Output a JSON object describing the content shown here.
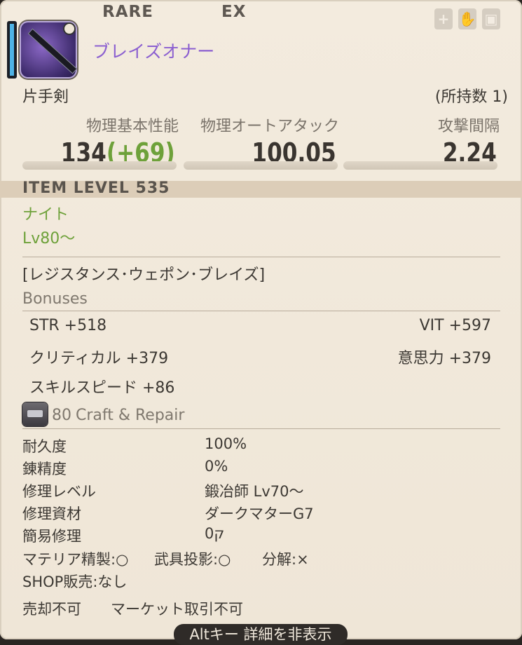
{
  "header": {
    "rarity": "RARE",
    "ex": "EX",
    "item_name": "ブレイズオナー",
    "icon_name": "sword-icon",
    "status_icons": [
      "plus-shield-icon",
      "hand-icon",
      "crate-icon"
    ]
  },
  "item_type": "片手剣",
  "owned_count": "(所持数 1)",
  "stats": [
    {
      "label": "物理基本性能",
      "value": "134",
      "bonus": "(+69)"
    },
    {
      "label": "物理オートアタック",
      "value": "100.05"
    },
    {
      "label": "攻撃間隔",
      "value": "2.24"
    }
  ],
  "item_level": "ITEM LEVEL 535",
  "job": "ナイト",
  "level_req": "Lv80～",
  "set_name": "[レジスタンス･ウェポン･ブレイズ]",
  "bonuses": {
    "heading": "Bonuses",
    "items": [
      {
        "left": "STR +518",
        "right": "VIT +597"
      },
      {
        "left": "クリティカル +379",
        "right": "意思力 +379"
      },
      {
        "left": "スキルスピード +86",
        "right": ""
      }
    ]
  },
  "craft": {
    "level": "80",
    "heading": "Craft & Repair",
    "icon_name": "anvil-icon",
    "rows": [
      {
        "label": "耐久度",
        "value": "100%"
      },
      {
        "label": "錬精度",
        "value": "0%"
      },
      {
        "label": "修理レベル",
        "value": "鍛冶師 Lv70～"
      },
      {
        "label": "修理資材",
        "value": "ダークマターG7"
      },
      {
        "label": "簡易修理",
        "value": "0ק"
      }
    ]
  },
  "flags": {
    "materia": "マテリア精製:○",
    "glamour": "武具投影:○",
    "desynth": "分解:×",
    "shop": "SHOP販売:なし",
    "sell": "売却不可",
    "market": "マーケット取引不可"
  },
  "footer": {
    "toggle_label": "Altキー 詳細を非表示"
  },
  "colors": {
    "name": "#8b5fd0",
    "green": "#6ea13a",
    "band": "#dccdb8"
  }
}
